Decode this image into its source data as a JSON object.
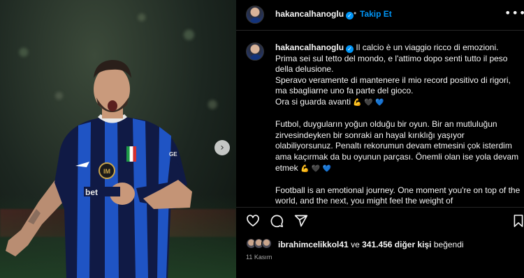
{
  "header": {
    "username": "hakancalhanoglu",
    "separator": "•",
    "follow_label": "Takip Et",
    "more_icon": "more-horizontal-icon"
  },
  "caption": {
    "username": "hakancalhanoglu",
    "paragraphs": [
      {
        "lines": [
          "Il calcio è un viaggio ricco di emozioni.",
          "Prima sei sul tetto del mondo, e l'attimo dopo senti tutto il peso della delusione.",
          "Speravo veramente di mantenere il mio record positivo di rigori, ma sbagliarne uno fa parte del gioco.",
          "Ora si guarda avanti"
        ]
      },
      {
        "lines": [
          "Futbol, duyguların yoğun olduğu bir oyun. Bir an mutluluğun zirvesindeyken bir sonraki an hayal kırıklığı yaşıyor olabiliyorsunuz. Penaltı rekorumun devam etmesini çok isterdim ama kaçırmak da bu oyunun parçası. Önemli olan ise yola devam etmek"
        ]
      },
      {
        "lines": [
          "Football is an emotional journey. One moment you're on top of the world, and the next, you might feel the weight of"
        ]
      }
    ],
    "emojis": [
      "💪",
      "🖤",
      "💙"
    ]
  },
  "actions": {
    "like_icon": "heart-icon",
    "comment_icon": "comment-icon",
    "share_icon": "share-icon",
    "save_icon": "bookmark-icon"
  },
  "likes": {
    "liker": "ibrahimcelikkol41",
    "connector": "ve",
    "count_text": "341.456 diğer kişi",
    "suffix": "beğendi"
  },
  "date": "11 Kasım",
  "colors": {
    "accent": "#0095f6",
    "background": "#000000",
    "text": "#f5f5f5",
    "muted": "#a8a8a8"
  }
}
